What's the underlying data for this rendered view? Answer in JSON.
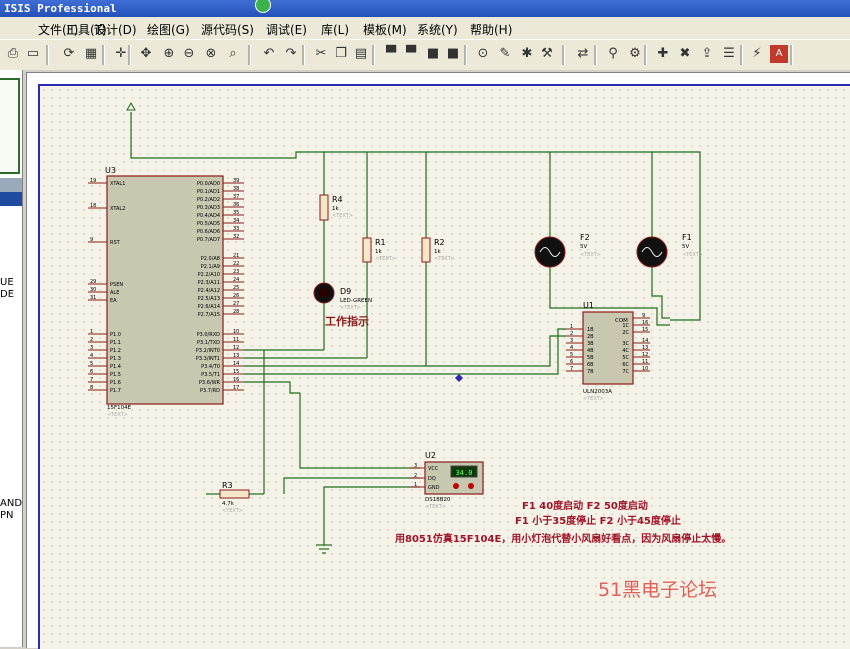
{
  "app": {
    "title": "ISIS Professional"
  },
  "menu": [
    "文件(F)",
    "工具(T)",
    "设计(D)",
    "绘图(G)",
    "源代码(S)",
    "调试(E)",
    "库(L)",
    "模板(M)",
    "系统(Y)",
    "帮助(H)"
  ],
  "toolbar_icons": [
    "print-icon",
    "page-setup-icon",
    "refresh-icon",
    "grid-icon",
    "origin-icon",
    "pan-icon",
    "zoom-in-icon",
    "zoom-out-icon",
    "zoom-all-icon",
    "zoom-area-icon",
    "undo-icon",
    "redo-icon",
    "cut-icon",
    "copy-icon",
    "paste-icon",
    "block-copy-icon",
    "block-move-icon",
    "block-rotate-icon",
    "block-delete-icon",
    "pick-device-icon",
    "make-device-icon",
    "packaging-icon",
    "decompose-icon",
    "wire-autorouter-icon",
    "search-icon",
    "property-tool-icon",
    "new-sheet-icon",
    "remove-sheet-icon",
    "goto-sheet-icon",
    "bom-icon",
    "netlist-icon",
    "ares-icon"
  ],
  "left_panel": {
    "labels": [
      "UE",
      "DE",
      "AND",
      "PN"
    ]
  },
  "schematic": {
    "u3": {
      "ref": "U3",
      "part": "15F104E",
      "text": "<TEXT>",
      "left_pins": [
        {
          "num": "19",
          "name": "XTAL1"
        },
        {
          "num": "18",
          "name": "XTAL2"
        },
        {
          "num": "9",
          "name": "RST"
        },
        {
          "num": "29",
          "name": "PSEN"
        },
        {
          "num": "30",
          "name": "ALE"
        },
        {
          "num": "31",
          "name": "EA"
        },
        {
          "num": "1",
          "name": "P1.0"
        },
        {
          "num": "2",
          "name": "P1.1"
        },
        {
          "num": "3",
          "name": "P1.2"
        },
        {
          "num": "4",
          "name": "P1.3"
        },
        {
          "num": "5",
          "name": "P1.4"
        },
        {
          "num": "6",
          "name": "P1.5"
        },
        {
          "num": "7",
          "name": "P1.6"
        },
        {
          "num": "8",
          "name": "P1.7"
        }
      ],
      "right_pins": [
        {
          "num": "39",
          "name": "P0.0/AD0"
        },
        {
          "num": "38",
          "name": "P0.1/AD1"
        },
        {
          "num": "37",
          "name": "P0.2/AD2"
        },
        {
          "num": "36",
          "name": "P0.3/AD3"
        },
        {
          "num": "35",
          "name": "P0.4/AD4"
        },
        {
          "num": "34",
          "name": "P0.5/AD5"
        },
        {
          "num": "33",
          "name": "P0.6/AD6"
        },
        {
          "num": "32",
          "name": "P0.7/AD7"
        },
        {
          "num": "21",
          "name": "P2.0/A8"
        },
        {
          "num": "22",
          "name": "P2.1/A9"
        },
        {
          "num": "23",
          "name": "P2.2/A10"
        },
        {
          "num": "24",
          "name": "P2.3/A11"
        },
        {
          "num": "25",
          "name": "P2.4/A12"
        },
        {
          "num": "26",
          "name": "P2.5/A13"
        },
        {
          "num": "27",
          "name": "P2.6/A14"
        },
        {
          "num": "28",
          "name": "P2.7/A15"
        },
        {
          "num": "10",
          "name": "P3.0/RXD"
        },
        {
          "num": "11",
          "name": "P3.1/TXD"
        },
        {
          "num": "12",
          "name": "P3.2/INT0"
        },
        {
          "num": "13",
          "name": "P3.3/INT1"
        },
        {
          "num": "14",
          "name": "P3.4/T0"
        },
        {
          "num": "15",
          "name": "P3.5/T1"
        },
        {
          "num": "16",
          "name": "P3.6/WR"
        },
        {
          "num": "17",
          "name": "P3.7/RD"
        }
      ]
    },
    "r4": {
      "ref": "R4",
      "value": "1k",
      "text": "<TEXT>"
    },
    "r1": {
      "ref": "R1",
      "value": "1k",
      "text": "<TEXT>"
    },
    "r2": {
      "ref": "R2",
      "value": "1k",
      "text": "<TEXT>"
    },
    "r3": {
      "ref": "R3",
      "value": "4.7k",
      "text": "<TEXT>"
    },
    "d9": {
      "ref": "D9",
      "part": "LED-GREEN",
      "text": "<TEXT>",
      "caption": "工作指示"
    },
    "f2": {
      "ref": "F2",
      "value": "5V",
      "text": "<TEXT>"
    },
    "f1": {
      "ref": "F1",
      "value": "5V",
      "text": "<TEXT>"
    },
    "u1": {
      "ref": "U1",
      "part": "ULN2003A",
      "text": "<TEXT>",
      "com_label": "COM",
      "left_pins": [
        {
          "num": "1",
          "name": "1B"
        },
        {
          "num": "2",
          "name": "2B"
        },
        {
          "num": "3",
          "name": "3B"
        },
        {
          "num": "4",
          "name": "4B"
        },
        {
          "num": "5",
          "name": "5B"
        },
        {
          "num": "6",
          "name": "6B"
        },
        {
          "num": "7",
          "name": "7B"
        }
      ],
      "right_pins": [
        {
          "num": "9",
          "name": ""
        },
        {
          "num": "16",
          "name": "1C"
        },
        {
          "num": "15",
          "name": "2C"
        },
        {
          "num": "14",
          "name": "3C"
        },
        {
          "num": "13",
          "name": "4C"
        },
        {
          "num": "12",
          "name": "5C"
        },
        {
          "num": "11",
          "name": "6C"
        },
        {
          "num": "10",
          "name": "7C"
        }
      ]
    },
    "u2": {
      "ref": "U2",
      "part": "DS18B20",
      "text": "<TEXT>",
      "display": "34.0",
      "pins": [
        {
          "num": "3",
          "name": "VCC"
        },
        {
          "num": "2",
          "name": "DQ"
        },
        {
          "num": "1",
          "name": "GND"
        }
      ]
    },
    "notes": [
      "F1 40度启动  F2 50度启动",
      "F1 小于35度停止  F2 小于45度停止",
      "用8051仿真15F104E，用小灯泡代替小风扇好看点，因为风扇停止太慢。"
    ],
    "watermark": "51黑电子论坛"
  }
}
